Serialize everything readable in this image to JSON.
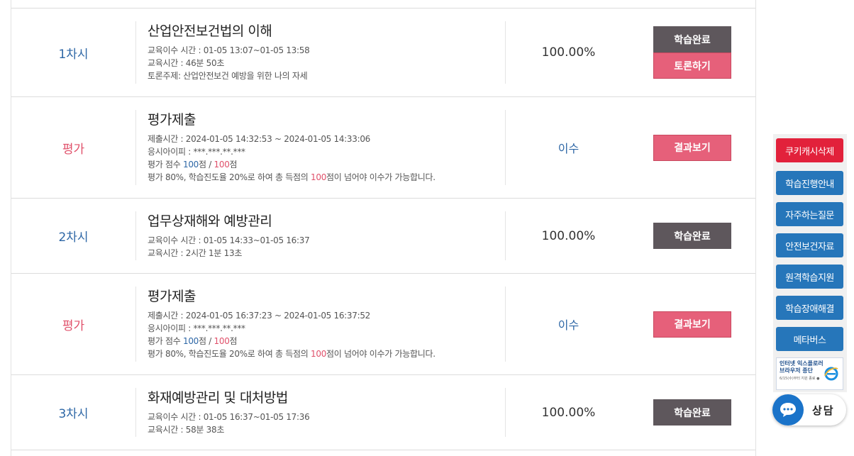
{
  "rows": [
    {
      "session": "1차시",
      "title": "산업안전보건법의 이해",
      "lines": [
        "교육이수 시간 : 01-05 13:07~01-05 13:58",
        "교육시간 : 46분 50초",
        "토론주제: 산업안전보건 예방을 위한 나의 자세"
      ],
      "rate": "100.00%",
      "buttons": [
        "학습완료",
        "토론하기"
      ]
    },
    {
      "session": "평가",
      "title": "평가제출",
      "lines": [
        "제출시간 : 2024-01-05 14:32:53 ~ 2024-01-05 14:33:06",
        "응시아이피 : ***.***.**.***"
      ],
      "score_prefix": "평가 점수 ",
      "score": "100",
      "score_mid": "점 / ",
      "score_total": "100",
      "score_suffix": "점",
      "rule_prefix": "평가 80%, 학습진도율 20%로 하여 총 득점의 ",
      "rule_value": "100",
      "rule_suffix": "점이 넘어야 이수가 가능합니다.",
      "rate": "이수",
      "buttons": [
        "결과보기"
      ]
    },
    {
      "session": "2차시",
      "title": "업무상재해와 예방관리",
      "lines": [
        "교육이수 시간 : 01-05 14:33~01-05 16:37",
        "교육시간 : 2시간 1분 13초"
      ],
      "rate": "100.00%",
      "buttons": [
        "학습완료"
      ]
    },
    {
      "session": "평가",
      "title": "평가제출",
      "lines": [
        "제출시간 : 2024-01-05 16:37:23 ~ 2024-01-05 16:37:52",
        "응시아이피 : ***.***.**.***"
      ],
      "score_prefix": "평가 점수 ",
      "score": "100",
      "score_mid": "점 / ",
      "score_total": "100",
      "score_suffix": "점",
      "rule_prefix": "평가 80%, 학습진도율 20%로 하여 총 득점의 ",
      "rule_value": "100",
      "rule_suffix": "점이 넘어야 이수가 가능합니다.",
      "rate": "이수",
      "buttons": [
        "결과보기"
      ]
    },
    {
      "session": "3차시",
      "title": "화재예방관리 및 대처방법",
      "lines": [
        "교육이수 시간 : 01-05 16:37~01-05 17:36",
        "교육시간 : 58분 38초"
      ],
      "rate": "100.00%",
      "buttons": [
        "학습완료"
      ]
    }
  ],
  "sidebar": {
    "items": [
      "쿠키캐시삭제",
      "학습진행안내",
      "자주하는질문",
      "안전보건자료",
      "원격학습지원",
      "학습장애해결",
      "메타버스"
    ],
    "ie_banner": [
      "인터넷 익스플로러",
      "브라우저 종단",
      "6/15(수)부터 지원 종료 ●"
    ],
    "chat_label": "상담"
  },
  "colors": {
    "dark_button": "#5e575c",
    "pink_button": "#e6607a",
    "session_blue": "#2e67a6",
    "eval_red": "#e0506a",
    "side_blue": "#2676ba",
    "side_red": "#e2213b"
  }
}
